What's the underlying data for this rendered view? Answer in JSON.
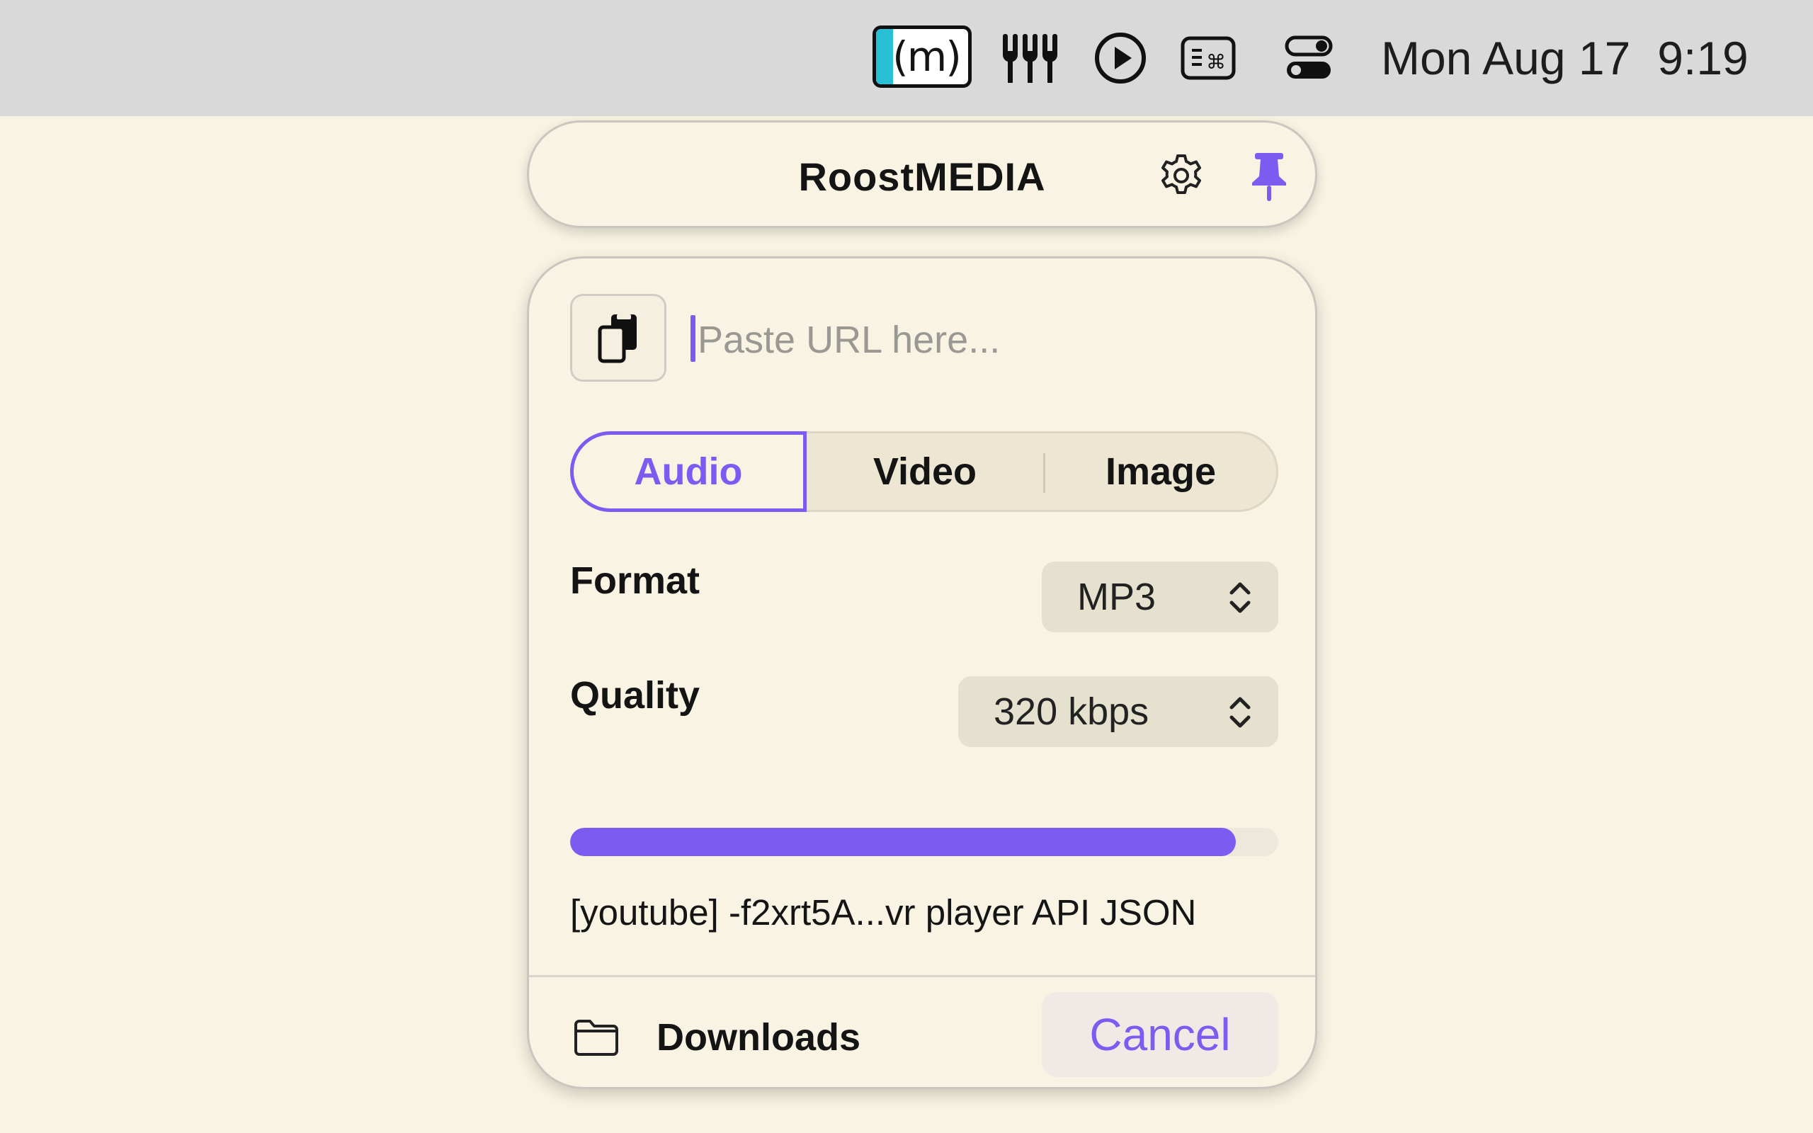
{
  "menubar": {
    "app_icon_text": "(m)",
    "icons": [
      "roostmedia-menubar-icon",
      "tuning-forks-icon",
      "play-circle-icon",
      "keyboard-shortcuts-icon",
      "control-center-icon"
    ],
    "date": "Mon Aug 17",
    "time": "9:19"
  },
  "header": {
    "title": "RoostMEDIA",
    "icons": [
      "gear-icon",
      "pin-icon"
    ]
  },
  "url_field": {
    "value": "",
    "placeholder": "Paste URL here..."
  },
  "media_tabs": [
    {
      "label": "Audio",
      "selected": true
    },
    {
      "label": "Video",
      "selected": false
    },
    {
      "label": "Image",
      "selected": false
    }
  ],
  "format": {
    "label": "Format",
    "value": "MP3"
  },
  "quality": {
    "label": "Quality",
    "value": "320 kbps"
  },
  "progress": {
    "fraction": 0.94
  },
  "status": "[youtube] -f2xrt5A...vr player API JSON",
  "footer": {
    "folder_label": "Downloads",
    "cancel_label": "Cancel"
  },
  "colors": {
    "accent": "#7b5cf0",
    "background": "#f8f3e2",
    "menubar": "#d9d9d9",
    "app_icon_accent": "#28c0d6"
  }
}
